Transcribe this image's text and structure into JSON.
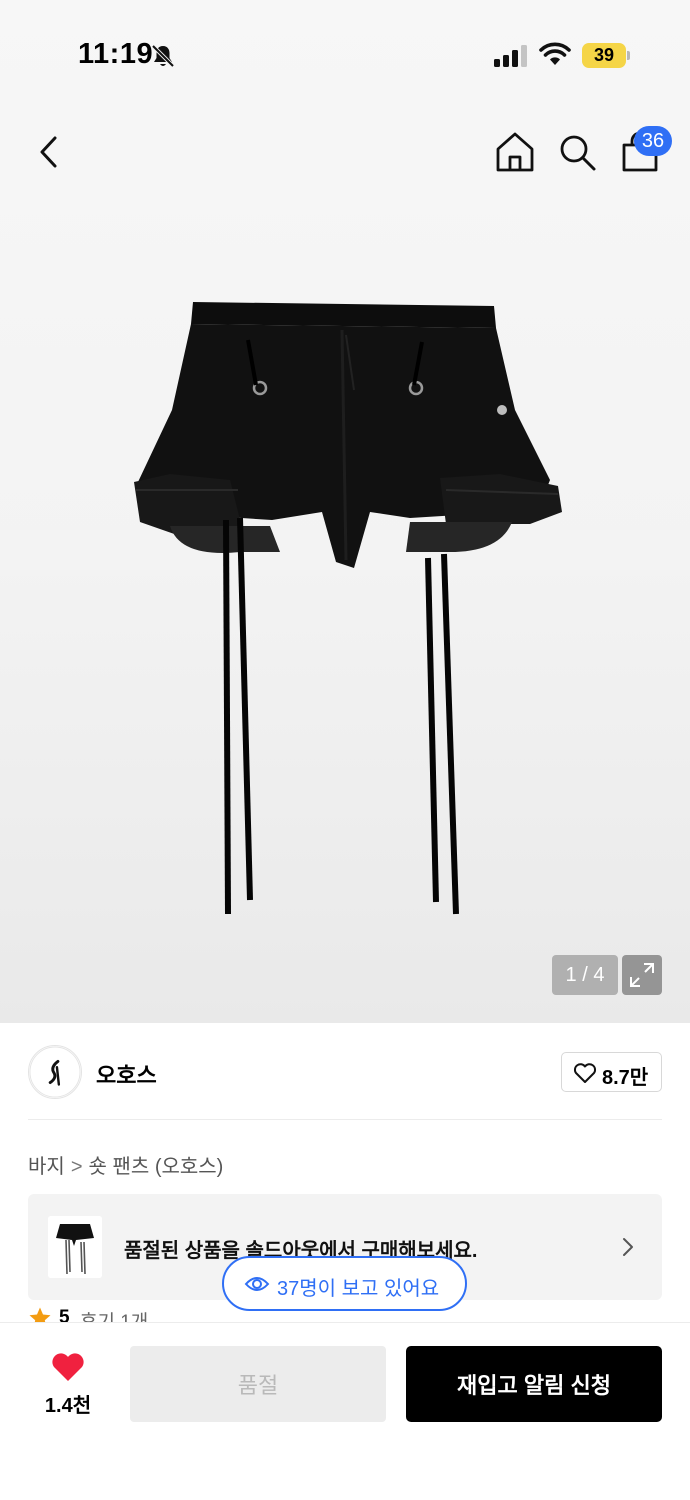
{
  "status_bar": {
    "time": "11:19",
    "battery": "39",
    "icons": [
      "bell-slash-icon",
      "signal-icon",
      "wifi-icon",
      "battery-icon"
    ]
  },
  "nav": {
    "icons": [
      "chevron-left-icon",
      "home-icon",
      "search-icon",
      "shopping-bag-icon"
    ],
    "cart_badge": "36"
  },
  "gallery": {
    "counter": "1 / 4",
    "icons": [
      "expand-icon"
    ]
  },
  "brand": {
    "name": "오호스",
    "like_count": "8.7만",
    "icons": [
      "heart-outline-icon"
    ]
  },
  "breadcrumb": {
    "items": [
      "바지",
      "숏 팬츠 (오호스)"
    ],
    "separator": ">"
  },
  "soldout_banner": {
    "text": "품절된 상품을 솔드아웃에서 구매해보세요."
  },
  "viewers": {
    "text": "37명이 보고 있어요"
  },
  "rating": {
    "score": "5",
    "reviews": "후기 1개"
  },
  "bottom_bar": {
    "wish_count": "1.4천",
    "soldout_label": "품절",
    "restock_label": "재입고 알림 신청"
  },
  "colors": {
    "accent_blue": "#2f6ff5",
    "battery_yellow": "#f5d547",
    "heart_red": "#f0213f",
    "star_orange": "#f39c12"
  }
}
